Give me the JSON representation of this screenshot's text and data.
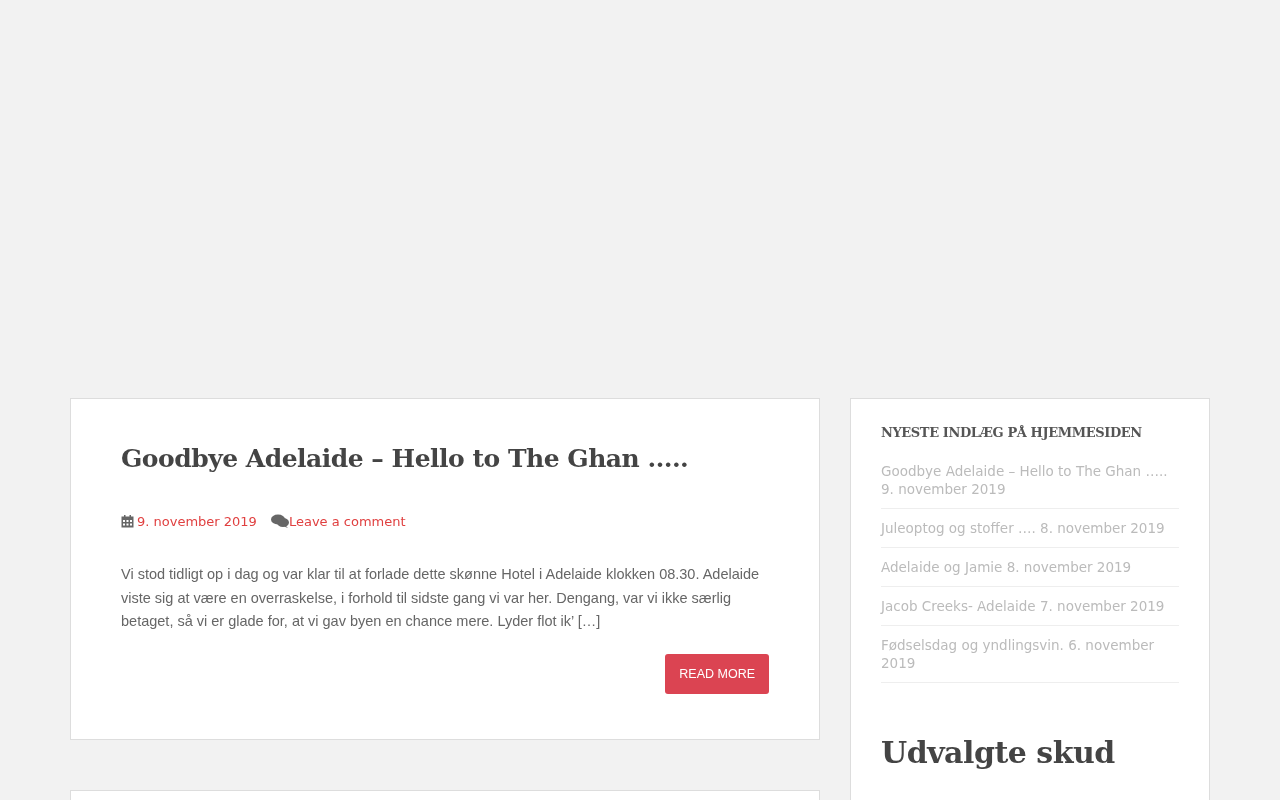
{
  "post": {
    "title": "Goodbye Adelaide – Hello to The Ghan …..",
    "date": "9. november 2019",
    "comment_link": "Leave a comment",
    "excerpt": "Vi stod tidligt op i dag og var klar til at forlade dette skønne Hotel i Adelaide klokken 08.30. Adelaide viste sig at være en overraskelse, i forhold til sidste gang vi var her. Dengang, var vi ikke særlig betaget, så vi er glade for, at vi gav byen en chance mere. Lyder flot ik’ […]",
    "button": "READ MORE"
  },
  "sidebar": {
    "heading": "NYESTE INDLÆG PÅ HJEMMESIDEN",
    "recent_posts": [
      {
        "title": "Goodbye Adelaide – Hello to The Ghan …..",
        "date": "9. november 2019"
      },
      {
        "title": "Juleoptog og stoffer ….",
        "date": "8. november 2019"
      },
      {
        "title": "Adelaide og Jamie",
        "date": "8. november 2019"
      },
      {
        "title": "Jacob Creeks- Adelaide",
        "date": "7. november 2019"
      },
      {
        "title": "Fødselsdag og yndlingsvin.",
        "date": "6. november 2019"
      }
    ],
    "section_heading": "Udvalgte skud"
  }
}
